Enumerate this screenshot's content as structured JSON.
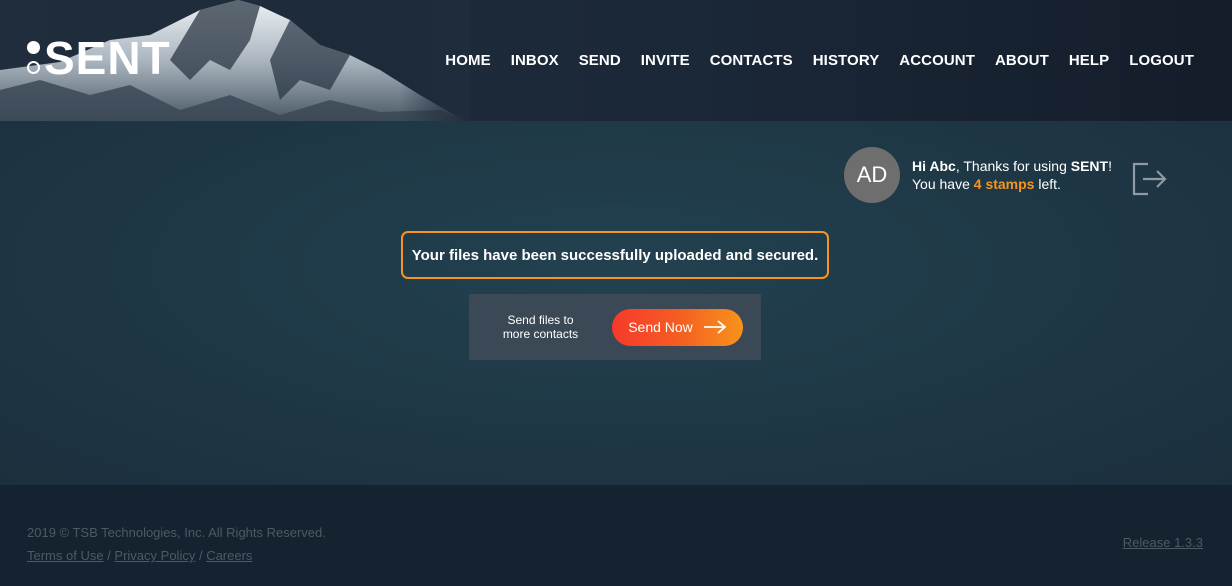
{
  "brand": {
    "logo_text": "SENT"
  },
  "nav": {
    "items": [
      "HOME",
      "INBOX",
      "SEND",
      "INVITE",
      "CONTACTS",
      "HISTORY",
      "ACCOUNT",
      "ABOUT",
      "HELP",
      "LOGOUT"
    ]
  },
  "user": {
    "initials": "AD",
    "hi": "Hi Abc",
    "thanks": ", Thanks for using ",
    "brand": "SENT",
    "excl": "!",
    "you_have": "You have ",
    "stamps": "4 stamps",
    "left": " left."
  },
  "alert": {
    "message": "Your files have been successfully uploaded and secured."
  },
  "send_panel": {
    "line1": "Send files to",
    "line2": "more contacts",
    "button_label": "Send Now"
  },
  "footer": {
    "copyright": "2019 © TSB Technologies, Inc. All Rights Reserved.",
    "terms": "Terms of Use",
    "privacy": "Privacy Policy",
    "careers": "Careers",
    "sep": " / ",
    "release": "Release 1.3.3"
  },
  "colors": {
    "accent": "#f7941d",
    "button_start": "#f7392b",
    "button_end": "#f7931b"
  }
}
